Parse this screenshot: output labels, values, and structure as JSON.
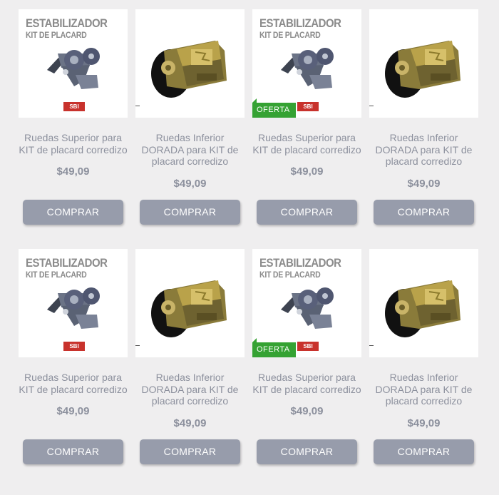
{
  "products": [
    {
      "title": "Ruedas Superior para KIT de placard corredizo",
      "price": "$49,09",
      "button": "COMPRAR",
      "image": "stabilizer",
      "image_title1": "ESTABILIZADOR",
      "image_title2": "KIT DE PLACARD",
      "logo": "SBI",
      "offer": ""
    },
    {
      "title": "Ruedas Inferior DORADA para KIT de placard corredizo",
      "price": "$49,09",
      "button": "COMPRAR",
      "image": "wheel",
      "image_title1": "",
      "image_title2": "",
      "logo": "",
      "offer": ""
    },
    {
      "title": "Ruedas Superior para KIT de placard corredizo",
      "price": "$49,09",
      "button": "COMPRAR",
      "image": "stabilizer",
      "image_title1": "ESTABILIZADOR",
      "image_title2": "KIT DE PLACARD",
      "logo": "SBI",
      "offer": "OFERTA"
    },
    {
      "title": "Ruedas Inferior DORADA para KIT de placard corredizo",
      "price": "$49,09",
      "button": "COMPRAR",
      "image": "wheel",
      "image_title1": "",
      "image_title2": "",
      "logo": "",
      "offer": ""
    },
    {
      "title": "Ruedas Superior para KIT de placard corredizo",
      "price": "$49,09",
      "button": "COMPRAR",
      "image": "stabilizer",
      "image_title1": "ESTABILIZADOR",
      "image_title2": "KIT DE PLACARD",
      "logo": "SBI",
      "offer": ""
    },
    {
      "title": "Ruedas Inferior DORADA para KIT de placard corredizo",
      "price": "$49,09",
      "button": "COMPRAR",
      "image": "wheel",
      "image_title1": "",
      "image_title2": "",
      "logo": "",
      "offer": ""
    },
    {
      "title": "Ruedas Superior para KIT de placard corredizo",
      "price": "$49,09",
      "button": "COMPRAR",
      "image": "stabilizer",
      "image_title1": "ESTABILIZADOR",
      "image_title2": "KIT DE PLACARD",
      "logo": "SBI",
      "offer": "OFERTA"
    },
    {
      "title": "Ruedas Inferior DORADA para KIT de placard corredizo",
      "price": "$49,09",
      "button": "COMPRAR",
      "image": "wheel",
      "image_title1": "",
      "image_title2": "",
      "logo": "",
      "offer": ""
    }
  ],
  "colors": {
    "background": "#efeeef",
    "text": "#8c909d",
    "button": "#979cab",
    "offer": "#35a233",
    "logo": "#c8322c"
  }
}
